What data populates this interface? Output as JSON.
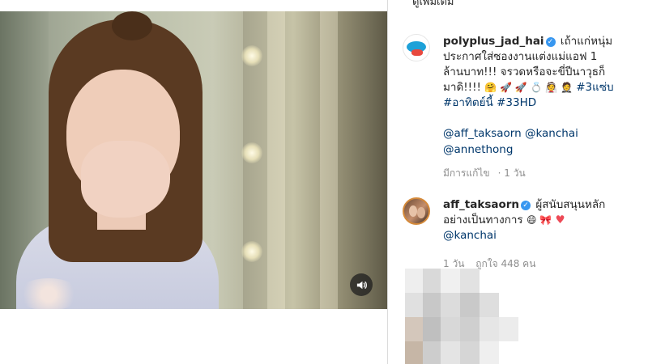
{
  "media": {
    "sound_icon": "speaker-volume-icon"
  },
  "panel": {
    "more_link": "ดูเพิ่มเติม"
  },
  "comments": [
    {
      "username": "polyplus_jad_hai",
      "avatar_icon": "brand-logo-avatar",
      "text_line1": "เถ้าแก่หนุ่ม",
      "text_line2": "ประกาศใส่ซองงานแต่งแม่แอฟ 1",
      "text_line3": "ล้านบาท!!! จรวดหรือจะขี่ปีนาวุธก็",
      "text_line4": "มาดิ!!!!",
      "emojis_line4": "🤗 🚀 🚀 💍 👰 🤵",
      "hashtag1": "#3แซ่บ",
      "hashtag2": "#อาทิตย์นี้",
      "hashtag3": "#33HD",
      "mention1": "@aff_taksaorn",
      "mention2": "@kanchai",
      "mention3": "@annethong",
      "edited_label": "มีการแก้ไข",
      "time": "1 วัน"
    },
    {
      "username": "aff_taksaorn",
      "avatar_icon": "couple-photo-avatar",
      "text_line1": "ผู้สนับสนุนหลัก",
      "text_line2": "อย่างเป็นทางการ",
      "emojis": "😄 🎀",
      "heart": "♥",
      "mention": "@kanchai",
      "time": "1 วัน",
      "likes": "ถูกใจ 448 คน"
    }
  ],
  "colors": {
    "link": "#00376b",
    "meta": "#8e8e8e",
    "verified": "#3897f0",
    "heart": "#ed4956"
  }
}
